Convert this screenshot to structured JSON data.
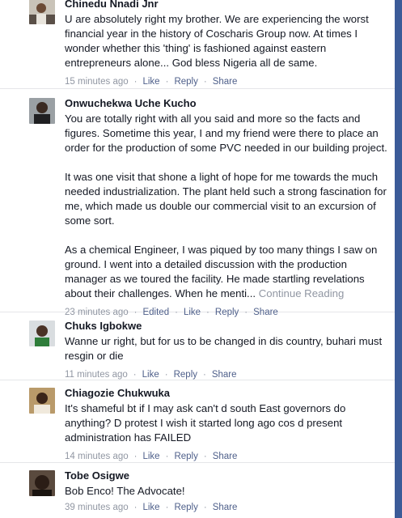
{
  "comments": [
    {
      "author": "Chinedu Nnadi Jnr",
      "paragraphs": [
        "U are absolutely right my brother. We are experiencing the worst financial year in the history of Coscharis Group now. At times I wonder whether this 'thing' is fashioned against eastern entrepreneurs alone... God bless Nigeria all de same."
      ],
      "time": "15 minutes ago",
      "like": "Like",
      "reply": "Reply",
      "share": "Share"
    },
    {
      "author": "Onwuchekwa Uche Kucho",
      "paragraphs": [
        "You are totally right with all you said and more so the facts and figures. Sometime this year, I and my friend were there to place an order for the production of some PVC needed in our building project.",
        "It was one visit that shone a light of hope for me towards the much needed industrialization. The plant held such a strong fascination for me, which made us double our commercial visit to an excursion of some sort.",
        "As a chemical Engineer, I was piqued by too many things I saw on ground. I went into a detailed discussion with the production manager as we toured the facility. He made startling revelations about their challenges. When he menti..."
      ],
      "continue": "Continue Reading",
      "time": "23 minutes ago",
      "edited": "Edited",
      "like": "Like",
      "reply": "Reply",
      "share": "Share"
    },
    {
      "author": "Chuks Igbokwe",
      "paragraphs": [
        "Wanne ur right, but for us to be changed in dis country, buhari must resgin or die"
      ],
      "time": "11 minutes ago",
      "like": "Like",
      "reply": "Reply",
      "share": "Share"
    },
    {
      "author": "Chiagozie Chukwuka",
      "paragraphs": [
        "It's shameful bt if I may ask can't d south East governors do anything?  D protest I wish it started long ago cos d present administration has FAILED"
      ],
      "time": "14 minutes ago",
      "like": "Like",
      "reply": "Reply",
      "share": "Share"
    },
    {
      "author": "Tobe Osigwe",
      "paragraphs": [
        "Bob Enco! The Advocate!"
      ],
      "time": "39 minutes ago",
      "like": "Like",
      "reply": "Reply",
      "share": "Share"
    }
  ],
  "colors": {
    "link": "#4e5f8a",
    "meta": "#9197a3",
    "rail": "#3b5b98"
  }
}
